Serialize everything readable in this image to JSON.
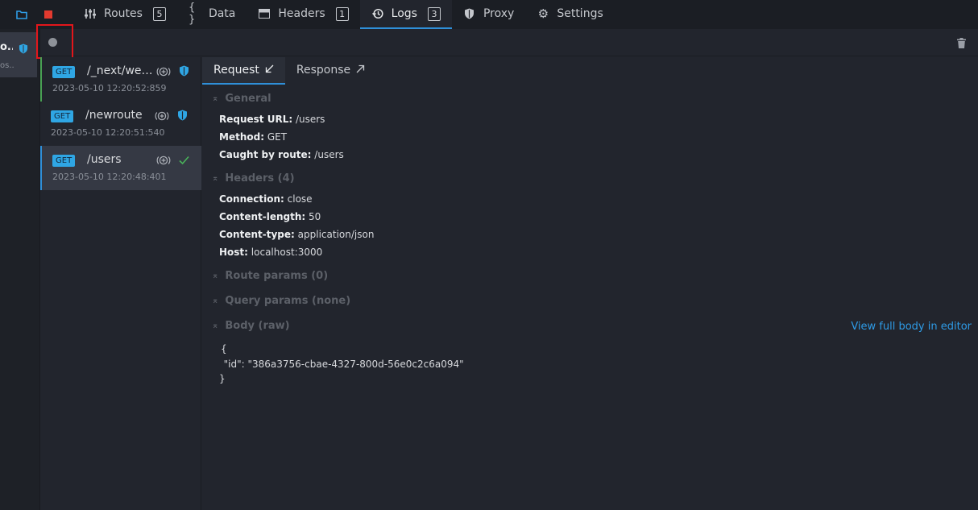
{
  "topbar": {
    "tabs": [
      {
        "label": "Routes",
        "badge": "5",
        "icon": "routes-sliders-icon"
      },
      {
        "label": "Data",
        "badge": "",
        "icon": "braces-icon"
      },
      {
        "label": "Headers",
        "badge": "1",
        "icon": "headers-icon"
      },
      {
        "label": "Logs",
        "badge": "3",
        "icon": "history-icon",
        "active": true
      },
      {
        "label": "Proxy",
        "badge": "",
        "icon": "shield-icon"
      },
      {
        "label": "Settings",
        "badge": "",
        "icon": "gear-icon"
      }
    ],
    "accent": "#2f8fd8",
    "stop_color": "#e33a2f"
  },
  "env": {
    "name": "o...",
    "sub": "os..."
  },
  "logs": [
    {
      "method": "GET",
      "path": "/_next/webpack-hmr",
      "time": "2023-05-10 12:20:52:859",
      "state_icon": "shield-icon"
    },
    {
      "method": "GET",
      "path": "/newroute",
      "time": "2023-05-10 12:20:51:540",
      "state_icon": "shield-icon"
    },
    {
      "method": "GET",
      "path": "/users",
      "time": "2023-05-10 12:20:48:401",
      "state_icon": "check-icon",
      "selected": true
    }
  ],
  "detail": {
    "tabs": {
      "request": "Request",
      "response": "Response"
    },
    "general": {
      "title": "General",
      "request_url_label": "Request URL:",
      "request_url": "/users",
      "method_label": "Method:",
      "method": "GET",
      "caught_label": "Caught by route:",
      "caught": "/users"
    },
    "headers": {
      "title": "Headers (4)",
      "items": [
        {
          "k": "Connection:",
          "v": "close"
        },
        {
          "k": "Content-length:",
          "v": "50"
        },
        {
          "k": "Content-type:",
          "v": "application/json"
        },
        {
          "k": "Host:",
          "v": "localhost:3000"
        }
      ]
    },
    "route_params_title": "Route params (0)",
    "query_params_title": "Query params (none)",
    "body_title": "Body (raw)",
    "view_full": "View full body in editor",
    "body_lines": [
      "{",
      "  \"id\": \"386a3756-cbae-4327-800d-56e0c2c6a094\"",
      "}"
    ]
  }
}
